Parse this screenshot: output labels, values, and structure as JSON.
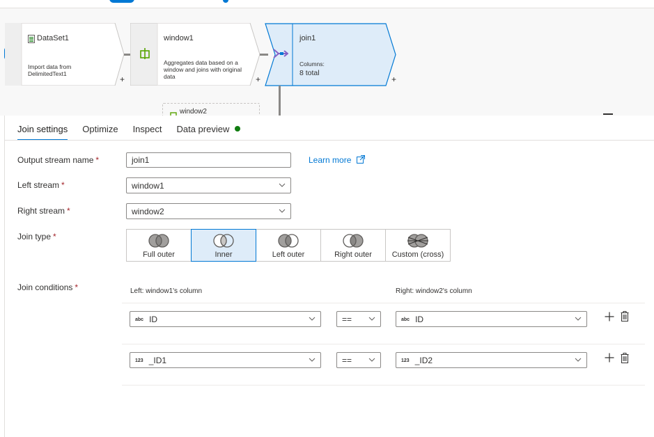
{
  "flow": {
    "nodes": [
      {
        "title": "DataSet1",
        "desc": "Import data from DelimitedText1"
      },
      {
        "title": "window1",
        "desc": "Aggregates data based on a window and joins with original data"
      },
      {
        "title": "join1",
        "columns_label": "Columns:",
        "columns_value": "8 total"
      }
    ],
    "partial_node_label": "window2",
    "plus_label": "+"
  },
  "tabs": [
    {
      "label": "Join settings",
      "active": true
    },
    {
      "label": "Optimize"
    },
    {
      "label": "Inspect"
    },
    {
      "label": "Data preview",
      "status": "green-dot"
    }
  ],
  "form": {
    "output_stream": {
      "label": "Output stream name",
      "value": "join1"
    },
    "learn_more": "Learn more",
    "left_stream": {
      "label": "Left stream",
      "value": "window1"
    },
    "right_stream": {
      "label": "Right stream",
      "value": "window2"
    },
    "join_type": {
      "label": "Join type",
      "options": [
        "Full outer",
        "Inner",
        "Left outer",
        "Right outer",
        "Custom (cross)"
      ],
      "selected": "Inner"
    },
    "required_mark": "*",
    "join_conditions": {
      "label": "Join conditions",
      "left_header": "Left: window1's column",
      "right_header": "Right: window2's column",
      "rows": [
        {
          "left_type": "abc",
          "left": "ID",
          "op": "==",
          "right_type": "abc",
          "right": "ID"
        },
        {
          "left_type": "123",
          "left": "_ID1",
          "op": "==",
          "right_type": "123",
          "right": "_ID2"
        }
      ]
    }
  },
  "colors": {
    "accent": "#0078d4",
    "selected_bg": "#deecf9",
    "required": "#a4262c",
    "status_ok": "#107c10"
  }
}
